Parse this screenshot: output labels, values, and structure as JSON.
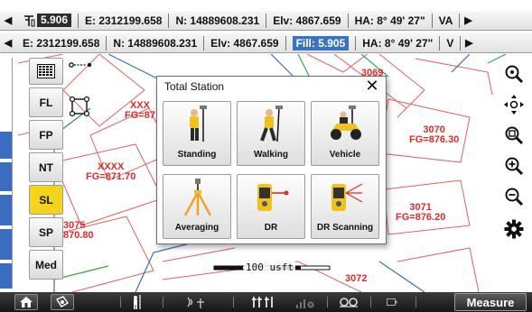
{
  "status_row1": {
    "rod_value": "5.906",
    "easting": "E: 2312199.658",
    "northing": "N: 14889608.231",
    "elevation": "Elv: 4867.659",
    "hz_angle": "HA: 8° 49' 27\"",
    "overflow": "VA"
  },
  "status_row2": {
    "easting": "E: 2312199.658",
    "northing": "N: 14889608.231",
    "elevation": "Elv: 4867.659",
    "fill": "Fill: 5.905",
    "hz_angle": "HA: 8° 49' 27\"",
    "overflow": "V"
  },
  "left_panel": {
    "items": [
      "FL",
      "FP",
      "NT",
      "SL",
      "SP",
      "Med"
    ],
    "active": "SL"
  },
  "map": {
    "points": [
      {
        "name": "3069",
        "fg": ""
      },
      {
        "name": "XXX",
        "fg": "FG=87"
      },
      {
        "name": "3070",
        "fg": "FG=876.30"
      },
      {
        "name": "XXXX",
        "fg": "FG=871.70"
      },
      {
        "name": "3071",
        "fg": "FG=876.20"
      },
      {
        "name": "3075",
        "fg": "870.80"
      },
      {
        "name": "3072",
        "fg": ""
      }
    ],
    "scale_label": "100 usft"
  },
  "dialog": {
    "title": "Total Station",
    "tiles": [
      "Standing",
      "Walking",
      "Vehicle",
      "Averaging",
      "DR",
      "DR Scanning"
    ]
  },
  "bottom_bar": {
    "measure_label": "Measure"
  },
  "colors": {
    "accent_blue": "#2a5ea8",
    "active_yellow": "#f3d41a",
    "point_red": "#e02a2a",
    "linework_red": "#e36060",
    "linework_blue": "#3c6fb8"
  }
}
